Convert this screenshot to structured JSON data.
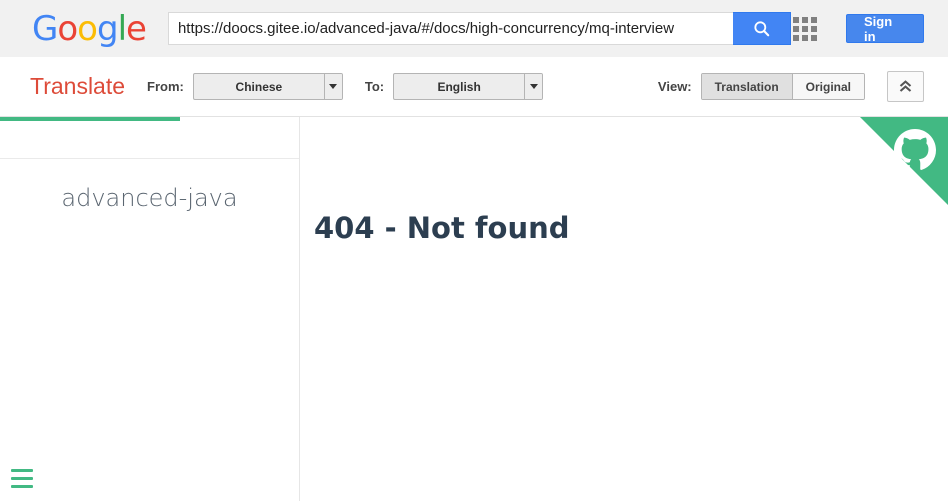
{
  "google_bar": {
    "logo": {
      "icon": "google-logo",
      "letters": [
        {
          "char": "G",
          "color": "#4285f4"
        },
        {
          "char": "o",
          "color": "#ea4335"
        },
        {
          "char": "o",
          "color": "#fbbc05"
        },
        {
          "char": "g",
          "color": "#4285f4"
        },
        {
          "char": "l",
          "color": "#34a853"
        },
        {
          "char": "e",
          "color": "#ea4335"
        }
      ]
    },
    "search": {
      "value": "https://doocs.gitee.io/advanced-java/#/docs/high-concurrency/mq-interview",
      "placeholder": "Search",
      "button_icon": "search-icon",
      "button_color": "#4285f4"
    },
    "apps_icon": "apps-grid-icon",
    "sign_in_label": "Sign in",
    "sign_in_color": "#4787ed"
  },
  "translate_bar": {
    "brand": "Translate",
    "brand_color": "#dd4b39",
    "from_label": "From:",
    "from_value": "Chinese",
    "to_label": "To:",
    "to_value": "English",
    "view_label": "View:",
    "view_options": [
      {
        "label": "Translation",
        "active": true
      },
      {
        "label": "Original",
        "active": false
      }
    ],
    "collapse_icon": "double-chevron-up-icon",
    "dropdown_icon": "chevron-down-icon"
  },
  "progress": {
    "color": "#42b983",
    "percent": 19
  },
  "sidebar": {
    "title": "advanced-java",
    "menu_icon": "hamburger-menu-icon",
    "menu_color": "#42b983",
    "items": []
  },
  "content": {
    "heading": "404 - Not found",
    "heading_color": "#2c3e50",
    "corner_ribbon": {
      "icon": "github-octocat-icon",
      "color": "#42b983"
    }
  }
}
